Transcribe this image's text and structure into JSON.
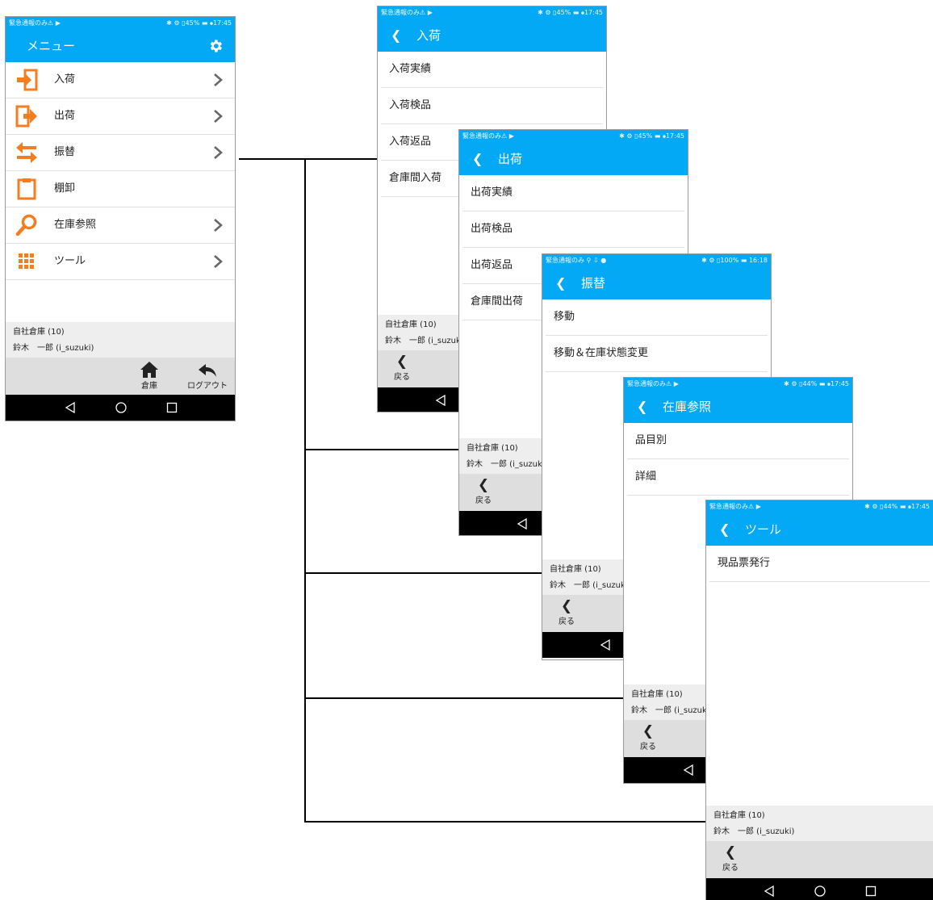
{
  "status_left": "緊急通報のみ⚠ ▶",
  "status_left_b": "緊急通報のみ ⚲ ⇩ ●",
  "status_right_a": "✱ ⚙ ▯45% ▬ ⦁17:45",
  "status_right_b": "✱ ⚙ ▯100% ▬ 16:18",
  "status_right_c": "✱ ⚙ ▯44% ▬ ⦁17:45",
  "back_label": "戻る",
  "footer": {
    "warehouse": "自社倉庫 (10)",
    "user": "鈴木　一郎 (i_suzuki)"
  },
  "menu": {
    "title": "メニュー",
    "items": [
      {
        "label": "入荷",
        "icon": "login-icon"
      },
      {
        "label": "出荷",
        "icon": "logout-icon"
      },
      {
        "label": "振替",
        "icon": "transfer-arrows-icon"
      },
      {
        "label": "棚卸",
        "icon": "clipboard-icon"
      },
      {
        "label": "在庫参照",
        "icon": "search-icon"
      },
      {
        "label": "ツール",
        "icon": "apps-grid-icon"
      }
    ],
    "home_label": "倉庫",
    "logout_label": "ログアウト"
  },
  "screens": {
    "nyuka": {
      "title": "入荷",
      "items": [
        "入荷実績",
        "入荷検品",
        "入荷返品",
        "倉庫間入荷"
      ]
    },
    "shukka": {
      "title": "出荷",
      "items": [
        "出荷実績",
        "出荷検品",
        "出荷返品",
        "倉庫間出荷"
      ]
    },
    "furikae": {
      "title": "振替",
      "items": [
        "移動",
        "移動＆在庫状態変更"
      ]
    },
    "zaiko": {
      "title": "在庫参照",
      "items": [
        "品目別",
        "詳細"
      ]
    },
    "tool": {
      "title": "ツール",
      "items": [
        "現品票発行"
      ]
    }
  },
  "colors": {
    "appbar": "#03a9f4",
    "icon_orange": "#f47d20",
    "navbar": "#000000"
  }
}
